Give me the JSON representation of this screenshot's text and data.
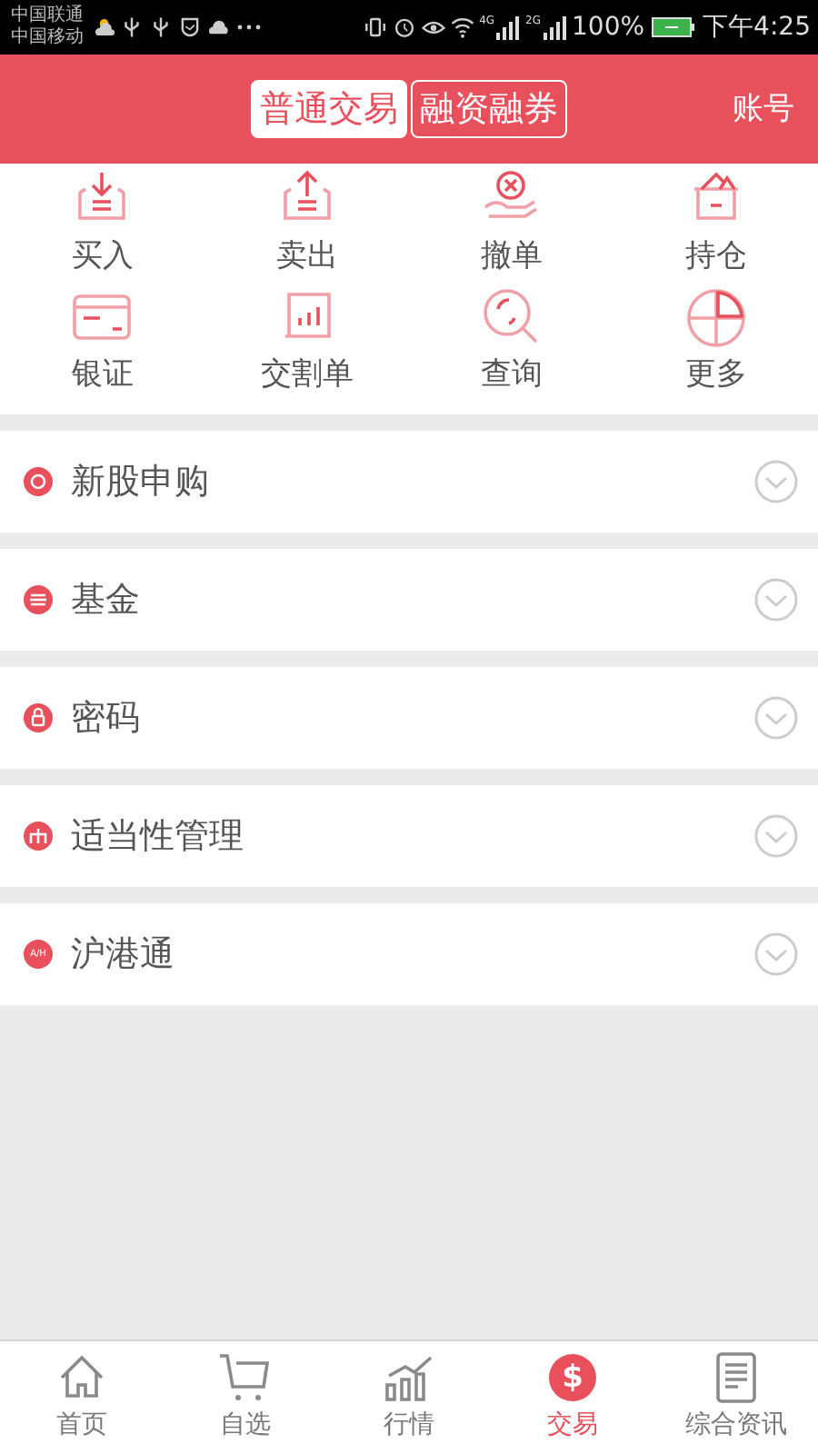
{
  "status_bar": {
    "carriers": [
      "中国联通",
      "中国移动"
    ],
    "left_icons": [
      {
        "kind": "weather"
      },
      {
        "kind": "usb"
      },
      {
        "kind": "usb"
      },
      {
        "kind": "shield"
      },
      {
        "kind": "cloud"
      },
      {
        "kind": "more"
      }
    ],
    "right_icons": [
      {
        "kind": "vibrate"
      },
      {
        "kind": "alarm"
      },
      {
        "kind": "eye"
      },
      {
        "kind": "wifi"
      }
    ],
    "signals": [
      {
        "network": "4G"
      },
      {
        "network": "2G"
      }
    ],
    "battery_text": "100%",
    "time": "下午4:25"
  },
  "header": {
    "tabs": [
      {
        "label": "普通交易",
        "selected": true
      },
      {
        "label": "融资融券",
        "selected": false
      }
    ],
    "account": "账号"
  },
  "actions": [
    {
      "label": "买入",
      "kind": "buy"
    },
    {
      "label": "卖出",
      "kind": "sell"
    },
    {
      "label": "撤单",
      "kind": "cancel"
    },
    {
      "label": "持仓",
      "kind": "holdings"
    },
    {
      "label": "银证",
      "kind": "card"
    },
    {
      "label": "交割单",
      "kind": "statement"
    },
    {
      "label": "查询",
      "kind": "search"
    },
    {
      "label": "更多",
      "kind": "more"
    }
  ],
  "menu": [
    {
      "label": "新股申购",
      "kind": "ipo",
      "expanded": false
    },
    {
      "label": "基金",
      "kind": "fund",
      "expanded": false
    },
    {
      "label": "密码",
      "kind": "lock",
      "expanded": false
    },
    {
      "label": "适当性管理",
      "kind": "suitability",
      "expanded": false
    },
    {
      "label": "沪港通",
      "kind": "connect",
      "badge": "A/H",
      "expanded": false
    }
  ],
  "bottom_nav": [
    {
      "label": "首页",
      "kind": "home",
      "selected": false
    },
    {
      "label": "自选",
      "kind": "cart",
      "selected": false
    },
    {
      "label": "行情",
      "kind": "chart",
      "selected": false
    },
    {
      "label": "交易",
      "kind": "trade",
      "glyph": "$",
      "selected": true
    },
    {
      "label": "综合资讯",
      "kind": "news",
      "selected": false
    }
  ]
}
